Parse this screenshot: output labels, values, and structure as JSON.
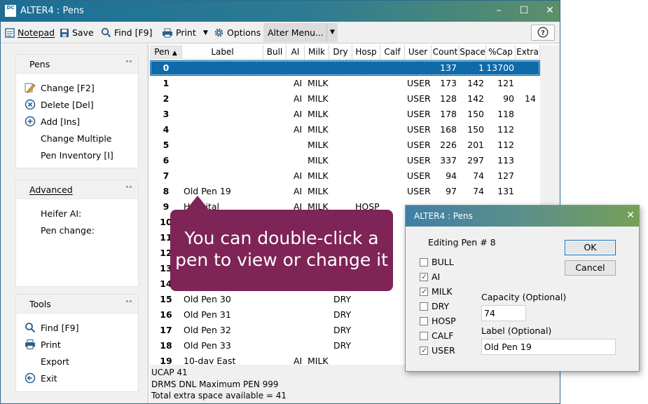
{
  "window": {
    "title": "ALTER4 : Pens",
    "icon_text": "DC"
  },
  "toolbar": {
    "notepad": "Notepad",
    "save": "Save",
    "find": "Find [F9]",
    "print": "Print",
    "options": "Options",
    "alter_menu": "Alter Menu..."
  },
  "sidebar": {
    "pens": {
      "title": "Pens",
      "items": [
        "Change [F2]",
        "Delete [Del]",
        "Add [Ins]",
        "Change Multiple",
        "Pen Inventory [I]"
      ]
    },
    "advanced": {
      "title": "Advanced",
      "items": [
        "Heifer AI:",
        "Pen change:"
      ]
    },
    "tools": {
      "title": "Tools",
      "items": [
        "Find [F9]",
        "Print",
        "Export",
        "Exit"
      ]
    }
  },
  "table": {
    "columns": [
      "Pen",
      "Label",
      "Bull",
      "AI",
      "Milk",
      "Dry",
      "Hosp",
      "Calf",
      "User",
      "Count",
      "Space",
      "%Cap",
      "Extra"
    ],
    "rows": [
      {
        "pen": "0",
        "label": "",
        "bull": "",
        "ai": "",
        "milk": "",
        "dry": "",
        "hosp": "",
        "calf": "",
        "user": "",
        "count": "137",
        "space": "1",
        "cap": "13700",
        "extra": ""
      },
      {
        "pen": "1",
        "label": "",
        "bull": "",
        "ai": "AI",
        "milk": "MILK",
        "dry": "",
        "hosp": "",
        "calf": "",
        "user": "USER",
        "count": "173",
        "space": "142",
        "cap": "121",
        "extra": ""
      },
      {
        "pen": "2",
        "label": "",
        "bull": "",
        "ai": "AI",
        "milk": "MILK",
        "dry": "",
        "hosp": "",
        "calf": "",
        "user": "USER",
        "count": "128",
        "space": "142",
        "cap": "90",
        "extra": "14"
      },
      {
        "pen": "3",
        "label": "",
        "bull": "",
        "ai": "AI",
        "milk": "MILK",
        "dry": "",
        "hosp": "",
        "calf": "",
        "user": "USER",
        "count": "178",
        "space": "150",
        "cap": "118",
        "extra": ""
      },
      {
        "pen": "4",
        "label": "",
        "bull": "",
        "ai": "AI",
        "milk": "MILK",
        "dry": "",
        "hosp": "",
        "calf": "",
        "user": "USER",
        "count": "168",
        "space": "150",
        "cap": "112",
        "extra": ""
      },
      {
        "pen": "5",
        "label": "",
        "bull": "",
        "ai": "",
        "milk": "MILK",
        "dry": "",
        "hosp": "",
        "calf": "",
        "user": "USER",
        "count": "226",
        "space": "201",
        "cap": "112",
        "extra": ""
      },
      {
        "pen": "6",
        "label": "",
        "bull": "",
        "ai": "",
        "milk": "MILK",
        "dry": "",
        "hosp": "",
        "calf": "",
        "user": "USER",
        "count": "337",
        "space": "297",
        "cap": "113",
        "extra": ""
      },
      {
        "pen": "7",
        "label": "",
        "bull": "",
        "ai": "AI",
        "milk": "MILK",
        "dry": "",
        "hosp": "",
        "calf": "",
        "user": "USER",
        "count": "94",
        "space": "74",
        "cap": "127",
        "extra": ""
      },
      {
        "pen": "8",
        "label": "Old Pen 19",
        "bull": "",
        "ai": "AI",
        "milk": "MILK",
        "dry": "",
        "hosp": "",
        "calf": "",
        "user": "USER",
        "count": "97",
        "space": "74",
        "cap": "131",
        "extra": ""
      },
      {
        "pen": "9",
        "label": "Hospital",
        "bull": "",
        "ai": "AI",
        "milk": "MILK",
        "dry": "",
        "hosp": "HOSP",
        "calf": "",
        "user": "",
        "count": "",
        "space": "",
        "cap": "",
        "extra": ""
      },
      {
        "pen": "10",
        "label": "",
        "bull": "",
        "ai": "",
        "milk": "",
        "dry": "",
        "hosp": "",
        "calf": "",
        "user": "",
        "count": "",
        "space": "",
        "cap": "",
        "extra": ""
      },
      {
        "pen": "11",
        "label": "",
        "bull": "",
        "ai": "",
        "milk": "",
        "dry": "",
        "hosp": "",
        "calf": "",
        "user": "",
        "count": "",
        "space": "",
        "cap": "",
        "extra": ""
      },
      {
        "pen": "12",
        "label": "",
        "bull": "",
        "ai": "",
        "milk": "",
        "dry": "",
        "hosp": "",
        "calf": "",
        "user": "",
        "count": "",
        "space": "",
        "cap": "",
        "extra": ""
      },
      {
        "pen": "13",
        "label": "",
        "bull": "",
        "ai": "",
        "milk": "",
        "dry": "",
        "hosp": "",
        "calf": "",
        "user": "",
        "count": "",
        "space": "",
        "cap": "",
        "extra": ""
      },
      {
        "pen": "14",
        "label": "",
        "bull": "",
        "ai": "",
        "milk": "",
        "dry": "",
        "hosp": "",
        "calf": "",
        "user": "",
        "count": "",
        "space": "",
        "cap": "",
        "extra": ""
      },
      {
        "pen": "15",
        "label": "Old Pen 30",
        "bull": "",
        "ai": "",
        "milk": "",
        "dry": "DRY",
        "hosp": "",
        "calf": "",
        "user": "",
        "count": "",
        "space": "",
        "cap": "",
        "extra": ""
      },
      {
        "pen": "16",
        "label": "Old Pen 31",
        "bull": "",
        "ai": "",
        "milk": "",
        "dry": "DRY",
        "hosp": "",
        "calf": "",
        "user": "",
        "count": "",
        "space": "",
        "cap": "",
        "extra": ""
      },
      {
        "pen": "17",
        "label": "Old Pen 32",
        "bull": "",
        "ai": "",
        "milk": "",
        "dry": "DRY",
        "hosp": "",
        "calf": "",
        "user": "",
        "count": "",
        "space": "",
        "cap": "",
        "extra": ""
      },
      {
        "pen": "18",
        "label": "Old Pen 33",
        "bull": "",
        "ai": "",
        "milk": "",
        "dry": "DRY",
        "hosp": "",
        "calf": "",
        "user": "",
        "count": "",
        "space": "",
        "cap": "",
        "extra": ""
      },
      {
        "pen": "19",
        "label": "10-day East",
        "bull": "",
        "ai": "AI",
        "milk": "MILK",
        "dry": "",
        "hosp": "",
        "calf": "",
        "user": "",
        "count": "",
        "space": "",
        "cap": "",
        "extra": ""
      }
    ]
  },
  "status": {
    "lines": [
      "UCAP 41",
      "DRMS DNL Maximum PEN 999",
      "Total extra space available = 41"
    ]
  },
  "callout": {
    "line1": "You can double-click a",
    "line2": "pen to view or change it"
  },
  "dialog": {
    "title": "ALTER4 : Pens",
    "editing": "Editing Pen # 8",
    "checkboxes": [
      {
        "label": "BULL",
        "checked": false
      },
      {
        "label": "AI",
        "checked": true
      },
      {
        "label": "MILK",
        "checked": true
      },
      {
        "label": "DRY",
        "checked": false
      },
      {
        "label": "HOSP",
        "checked": false
      },
      {
        "label": "CALF",
        "checked": false
      },
      {
        "label": "USER",
        "checked": true
      }
    ],
    "capacity_label": "Capacity (Optional)",
    "capacity_value": "74",
    "label_label": "Label (Optional)",
    "label_value": "Old Pen 19",
    "ok": "OK",
    "cancel": "Cancel"
  },
  "colors": {
    "selection": "#0e6aa8",
    "callout": "#7e2456",
    "titlebar": "#1c6e97"
  }
}
